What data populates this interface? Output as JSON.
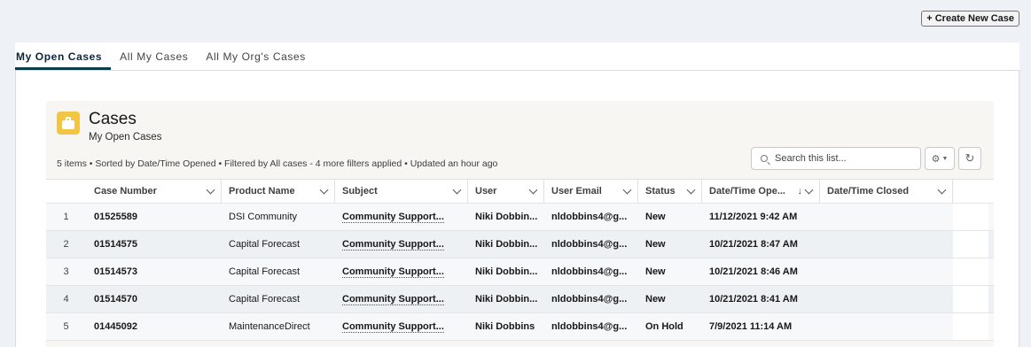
{
  "actions": {
    "create_label": "+ Create New Case"
  },
  "tabs": [
    {
      "label": "My Open Cases",
      "active": true
    },
    {
      "label": "All My Cases",
      "active": false
    },
    {
      "label": "All My Org's Cases",
      "active": false
    }
  ],
  "list": {
    "title": "Cases",
    "subtitle": "My Open Cases",
    "meta": "5 items • Sorted by Date/Time Opened • Filtered by All cases - 4 more filters applied • Updated an hour ago",
    "search_placeholder": "Search this list...",
    "icon": "briefcase-icon",
    "icon_color": "#f2c644"
  },
  "columns": {
    "case_number": "Case Number",
    "product_name": "Product Name",
    "subject": "Subject",
    "user": "User",
    "user_email": "User Email",
    "status": "Status",
    "date_opened": "Date/Time Ope...",
    "date_closed": "Date/Time Closed"
  },
  "rows": [
    {
      "n": "1",
      "case": "01525589",
      "product": "DSI Community",
      "subject": "Community Support...",
      "user": "Niki Dobbin...",
      "email": "nldobbins4@g...",
      "status": "New",
      "opened": "11/12/2021 9:42 AM",
      "closed": ""
    },
    {
      "n": "2",
      "case": "01514575",
      "product": "Capital Forecast",
      "subject": "Community Support...",
      "user": "Niki Dobbin...",
      "email": "nldobbins4@g...",
      "status": "New",
      "opened": "10/21/2021 8:47 AM",
      "closed": ""
    },
    {
      "n": "3",
      "case": "01514573",
      "product": "Capital Forecast",
      "subject": "Community Support...",
      "user": "Niki Dobbin...",
      "email": "nldobbins4@g...",
      "status": "New",
      "opened": "10/21/2021 8:46 AM",
      "closed": ""
    },
    {
      "n": "4",
      "case": "01514570",
      "product": "Capital Forecast",
      "subject": "Community Support...",
      "user": "Niki Dobbin...",
      "email": "nldobbins4@g...",
      "status": "New",
      "opened": "10/21/2021 8:41 AM",
      "closed": ""
    },
    {
      "n": "5",
      "case": "01445092",
      "product": "MaintenanceDirect",
      "subject": "Community Support...",
      "user": "Niki Dobbins",
      "email": "nldobbins4@g...",
      "status": "On Hold",
      "opened": "7/9/2021 11:14 AM",
      "closed": ""
    }
  ]
}
